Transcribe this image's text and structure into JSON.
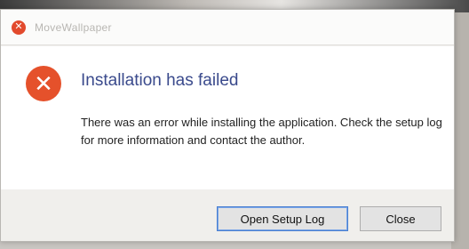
{
  "window": {
    "title": "MoveWallpaper"
  },
  "icons": {
    "title_icon": "error-icon",
    "main_icon": "error-icon",
    "glyph": "✕",
    "error_color": "#e5512b"
  },
  "dialog": {
    "heading": "Installation has failed",
    "message": "There was an error while installing the application. Check the setup log for more information and contact the author."
  },
  "buttons": {
    "open_log": "Open Setup Log",
    "close": "Close"
  }
}
